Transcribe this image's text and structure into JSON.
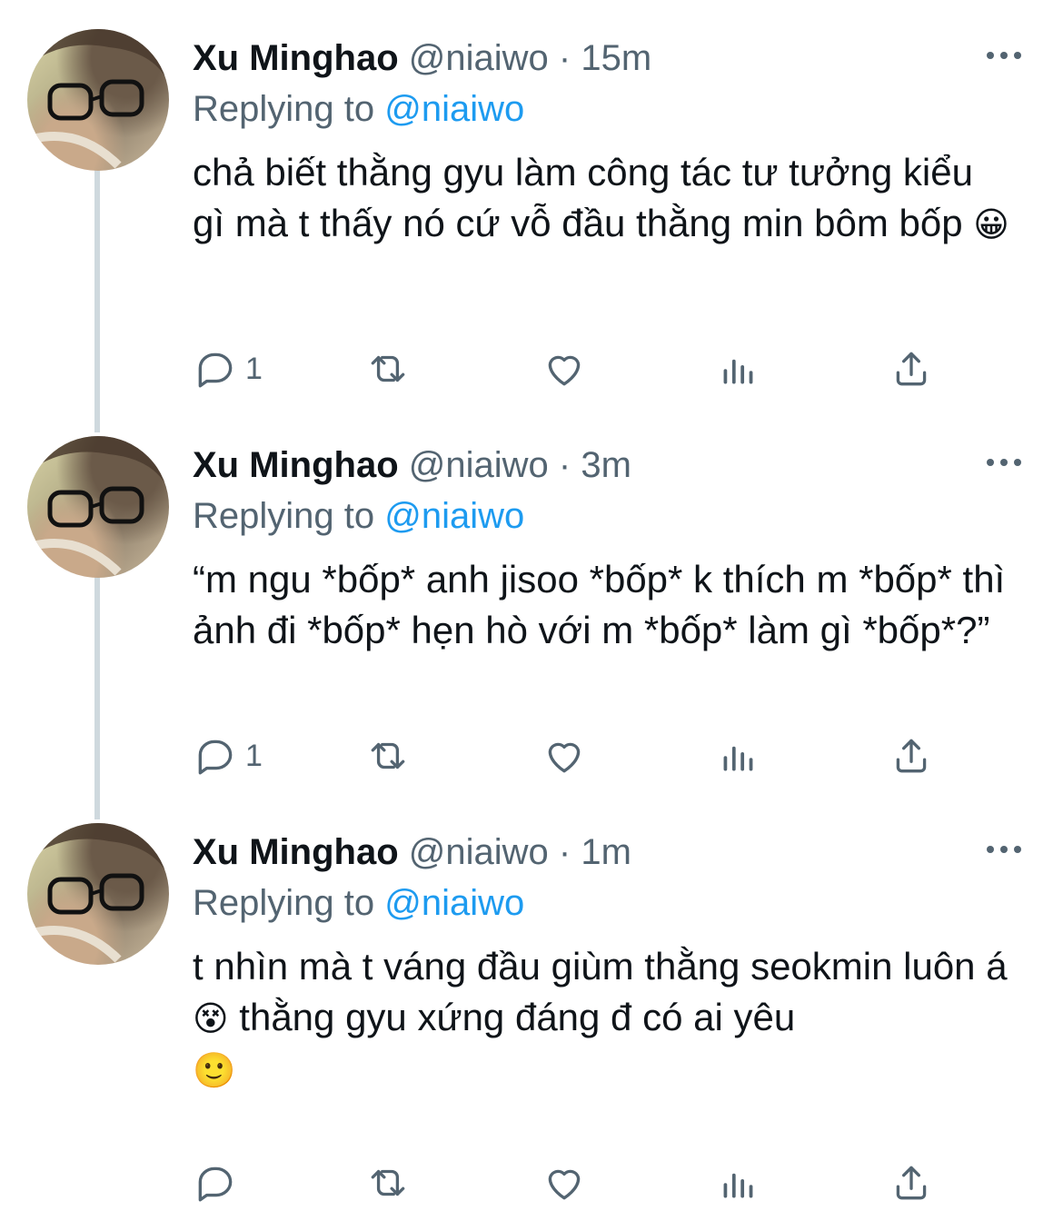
{
  "tweets": [
    {
      "name": "Xu Minghao",
      "handle": "@niaiwo",
      "time": "15m",
      "replying_prefix": "Replying to",
      "replying_to": "@niaiwo",
      "text": "chả biết thằng gyu làm công tác tư tưởng kiểu gì mà t thấy nó cứ vỗ đầu thằng min bôm bốp",
      "emoji": "😀",
      "reply_count": "1"
    },
    {
      "name": "Xu Minghao",
      "handle": "@niaiwo",
      "time": "3m",
      "replying_prefix": "Replying to",
      "replying_to": "@niaiwo",
      "text": "“m ngu *bốp* anh jisoo *bốp* k thích m *bốp* thì ảnh đi *bốp* hẹn hò với m *bốp* làm gì *bốp*?”",
      "reply_count": "1"
    },
    {
      "name": "Xu Minghao",
      "handle": "@niaiwo",
      "time": "1m",
      "replying_prefix": "Replying to",
      "replying_to": "@niaiwo",
      "text_part1": "t nhìn mà t váng đầu giùm thằng seokmin luôn á",
      "emoji1": "😵",
      "text_part2": "thằng gyu xứng đáng đ có ai yêu",
      "emoji2": "🙂",
      "reply_count": ""
    }
  ],
  "separator": "·",
  "colors": {
    "accent": "#1d9bf0",
    "secondary": "#536471",
    "thread_line": "#cfd9de"
  },
  "icons": [
    "reply-icon",
    "retweet-icon",
    "like-icon",
    "analytics-icon",
    "share-icon",
    "more-icon"
  ]
}
